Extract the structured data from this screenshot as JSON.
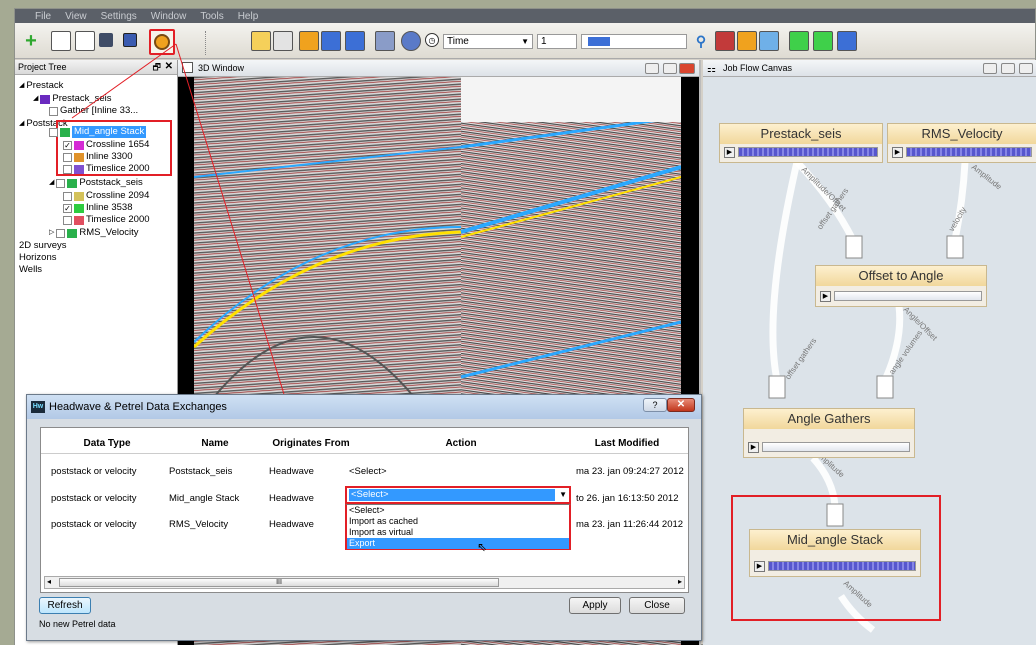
{
  "menu": [
    "File",
    "View",
    "Settings",
    "Window",
    "Tools",
    "Help"
  ],
  "toolbar": {
    "time_label": "Time",
    "frame_value": "1"
  },
  "project_tree": {
    "title": "Project Tree",
    "items": [
      {
        "label": "Prestack"
      },
      {
        "label": "Prestack_seis"
      },
      {
        "label": "Gather [Inline 33..."
      },
      {
        "label": "Poststack"
      },
      {
        "label": "Mid_angle Stack"
      },
      {
        "label": "Crossline 1654",
        "color": "#d52bd5"
      },
      {
        "label": "Inline 3300",
        "color": "#e0922a"
      },
      {
        "label": "Timeslice 2000",
        "color": "#8050d0"
      },
      {
        "label": "Poststack_seis"
      },
      {
        "label": "Crossline 2094",
        "color": "#d4c25a"
      },
      {
        "label": "Inline 3538",
        "color": "#2ecc40"
      },
      {
        "label": "Timeslice 2000",
        "color": "#e04f60"
      },
      {
        "label": "RMS_Velocity"
      },
      {
        "label": "2D surveys"
      },
      {
        "label": "Horizons"
      },
      {
        "label": "Wells"
      }
    ]
  },
  "window3d": {
    "title": "3D Window"
  },
  "jobflow": {
    "title": "Job Flow Canvas",
    "nodes": [
      {
        "title": "Prestack_seis"
      },
      {
        "title": "RMS_Velocity"
      },
      {
        "title": "Offset to Angle"
      },
      {
        "title": "Angle Gathers"
      },
      {
        "title": "Mid_angle Stack"
      }
    ],
    "links": [
      "Amplitude/Offset",
      "offset gathers",
      "Amplitude",
      "velocity",
      "Angle/Offset",
      "offset gathers",
      "angle volumes",
      "Amplitude",
      "Amplitude"
    ]
  },
  "dialog": {
    "icon": "Hw",
    "title": "Headwave & Petrel Data Exchanges",
    "headers": [
      "Data Type",
      "Name",
      "Originates From",
      "Action",
      "Last Modified"
    ],
    "rows": [
      [
        "poststack or velocity",
        "Poststack_seis",
        "Headwave",
        "<Select>",
        "ma 23. jan 09:24:27 2012"
      ],
      [
        "poststack or velocity",
        "Mid_angle Stack",
        "Headwave",
        "<Select>",
        "to 26. jan 16:13:50 2012"
      ],
      [
        "poststack or velocity",
        "RMS_Velocity",
        "Headwave",
        "",
        "ma 23. jan 11:26:44 2012"
      ]
    ],
    "dropdown_options": [
      "<Select>",
      "Import as cached",
      "Import as virtual",
      "Export"
    ],
    "scroll_mark": "III",
    "buttons": {
      "refresh": "Refresh",
      "apply": "Apply",
      "close": "Close"
    },
    "status": "No new Petrel data"
  },
  "colors": {
    "highlight": "#e21f26",
    "selection": "#3399ff"
  }
}
